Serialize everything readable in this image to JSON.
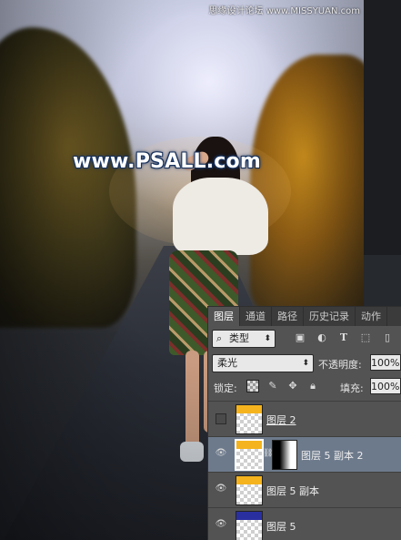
{
  "watermark_top": {
    "text": "思缘设计论坛 www.MISSYUAN.com"
  },
  "watermark_center": {
    "text": "www.PSALL.com"
  },
  "panel": {
    "tabs": [
      {
        "label": "图层",
        "active": true
      },
      {
        "label": "通道",
        "active": false
      },
      {
        "label": "路径",
        "active": false
      },
      {
        "label": "历史记录",
        "active": false
      },
      {
        "label": "动作",
        "active": false
      }
    ],
    "filter": {
      "label": "类型",
      "icons": [
        "image-filter-icon",
        "adjustment-filter-icon",
        "type-filter-icon",
        "shape-filter-icon",
        "smart-object-filter-icon"
      ]
    },
    "blend_mode": "柔光",
    "opacity_label": "不透明度:",
    "opacity_value": "100%",
    "lock_label": "锁定:",
    "fill_label": "填充:",
    "fill_value": "100%",
    "layers": [
      {
        "name": "图层 2",
        "visible": false,
        "selected": false,
        "has_mask": false,
        "thumb_color": "#f5b41e"
      },
      {
        "name": "图层 5 副本 2",
        "visible": true,
        "selected": true,
        "has_mask": true,
        "thumb_color": "#f5b41e"
      },
      {
        "name": "图层 5 副本",
        "visible": true,
        "selected": false,
        "has_mask": false,
        "thumb_color": "#f5b41e"
      },
      {
        "name": "图层 5",
        "visible": true,
        "selected": false,
        "has_mask": false,
        "thumb_color": "#2a2fa0"
      }
    ]
  },
  "colors": {
    "panel_bg": "#535353",
    "selected_row": "#6d7a8c",
    "tab_bar": "#3b3b3b"
  }
}
